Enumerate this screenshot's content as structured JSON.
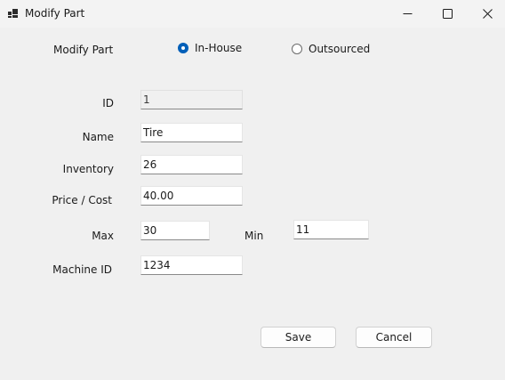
{
  "window": {
    "title": "Modify Part",
    "icon": "app-window-icon",
    "controls": {
      "minimize_icon": "minimize-icon",
      "maximize_icon": "maximize-icon",
      "close_icon": "close-icon"
    }
  },
  "form": {
    "heading": "Modify Part",
    "source_options": [
      {
        "label": "In-House",
        "checked": true
      },
      {
        "label": "Outsourced",
        "checked": false
      }
    ],
    "fields": {
      "id": {
        "label": "ID",
        "value": "1"
      },
      "name": {
        "label": "Name",
        "value": "Tire"
      },
      "inventory": {
        "label": "Inventory",
        "value": "26"
      },
      "price": {
        "label": "Price / Cost",
        "value": "40.00"
      },
      "max": {
        "label": "Max",
        "value": "30"
      },
      "min": {
        "label": "Min",
        "value": "11"
      },
      "machine_id": {
        "label": "Machine ID",
        "value": "1234"
      }
    },
    "buttons": {
      "save": "Save",
      "cancel": "Cancel"
    }
  },
  "colors": {
    "accent": "#005fb8",
    "background": "#f0f0f0",
    "titlebar": "#f3f3f3"
  }
}
